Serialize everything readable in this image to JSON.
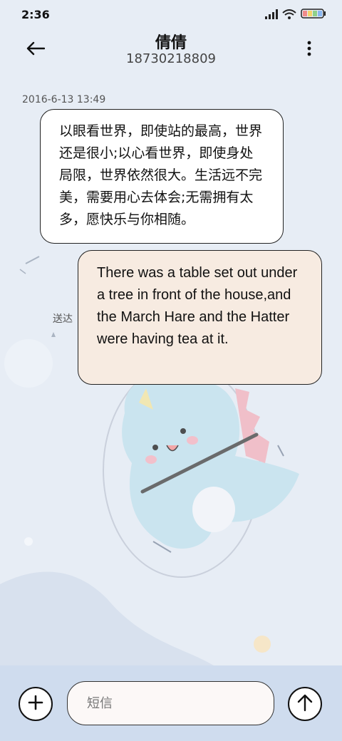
{
  "status_bar": {
    "time": "2:36",
    "icons": [
      "signal-icon",
      "wifi-icon",
      "battery-icon"
    ]
  },
  "header": {
    "contact_name": "倩倩",
    "contact_number": "18730218809",
    "back_icon": "arrow-left-icon",
    "more_icon": "more-vertical-icon"
  },
  "conversation": {
    "timestamp": "2016-6-13 13:49",
    "messages": [
      {
        "direction": "incoming",
        "text": "以眼看世界，即使站的最高，世界还是很小;以心看世界，即使身处局限，世界依然很大。生活远不完美，需要用心去体会;无需拥有太多，愿快乐与你相随。"
      },
      {
        "direction": "outgoing",
        "text": "There was a table set out under a tree in front of the house,and the March Hare and the Hatter were having tea at it.",
        "status": "送达"
      }
    ]
  },
  "composer": {
    "placeholder": "短信",
    "value": "",
    "add_icon": "plus-circle-icon",
    "send_icon": "arrow-up-circle-icon"
  },
  "colors": {
    "background": "#e7edf5",
    "incoming_bubble": "#ffffff",
    "outgoing_bubble": "#f7ebe1",
    "composer_bar": "#cfdcee"
  }
}
